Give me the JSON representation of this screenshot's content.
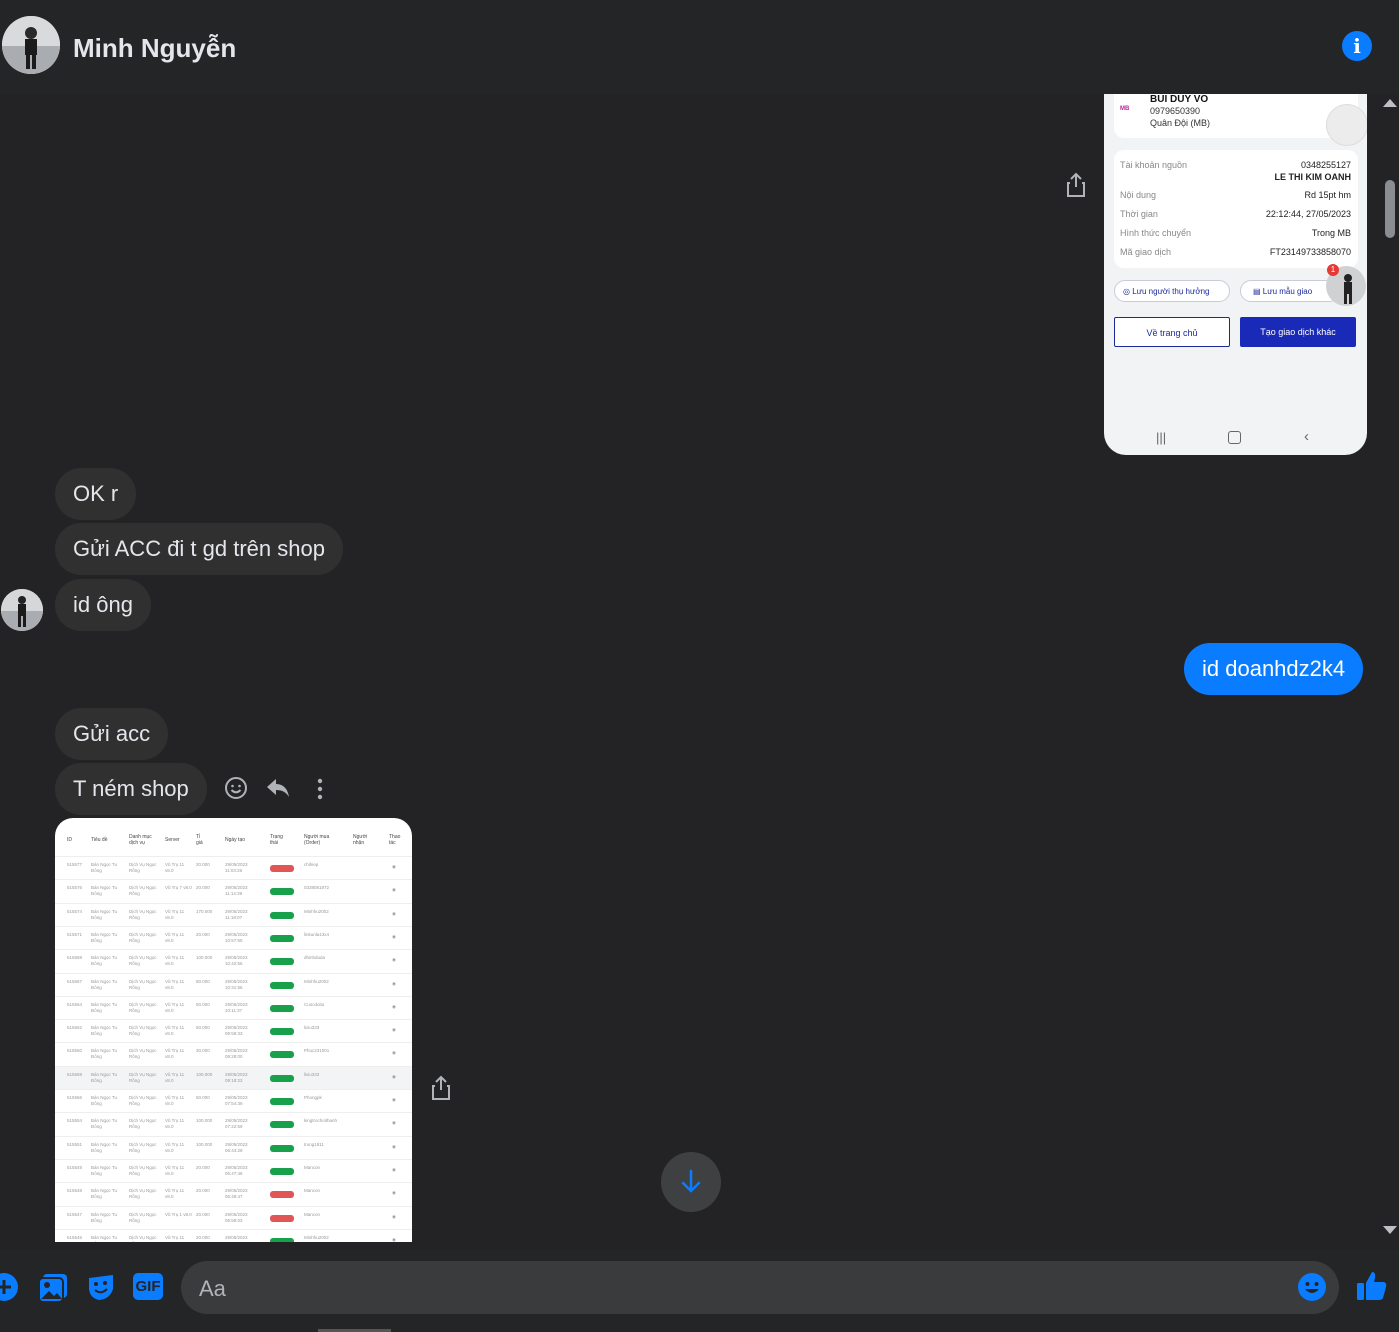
{
  "header": {
    "contact_name": "Minh Nguyễn",
    "info_icon": "info-icon"
  },
  "messages": {
    "m1": "OK r",
    "m2": "Gửi ACC đi t gd trên shop",
    "m3": "id ông",
    "m4": "id doanhdz2k4",
    "m5": "Gửi acc",
    "m6": "T ném shop"
  },
  "receipt": {
    "name": "BUI DUY VO",
    "phone": "0979650390",
    "bank": "Quân Đội (MB)",
    "bank_logo": "MB",
    "source_label": "Tài khoản nguồn",
    "source_number": "0348255127",
    "source_name": "LE THI KIM OANH",
    "content_label": "Nội dung",
    "content_value": "Rd 15pt hm",
    "time_label": "Thời gian",
    "time_value": "22:12:44, 27/05/2023",
    "method_label": "Hình thức chuyển",
    "method_value": "Trong MB",
    "code_label": "Mã giao dịch",
    "code_value": "FT23149733858070",
    "save_payee": "Lưu người thụ hưởng",
    "save_template": "Lưu mẫu giao",
    "home_button": "Về trang chủ",
    "new_tx_button": "Tạo giao dịch khác",
    "badge": "1"
  },
  "table": {
    "headers": [
      "ID",
      "Tiêu đề",
      "Danh mục dịch vụ",
      "Server",
      "Tỉ giá",
      "Ngày tạo",
      "Trạng thái",
      "Người mua (Order)",
      "Người nhận",
      "Thao tác"
    ],
    "rows": [
      {
        "id": "515577",
        "title": "Bán Ngọc Tu Đông",
        "cat": "Dịch Vụ Ngọc Rồng",
        "server": "Vũ Trụ 11 v8.0",
        "rate": "20.000",
        "date": "29/05/2023 11:03:26",
        "status": "bad",
        "buyer": "chihiep"
      },
      {
        "id": "515576",
        "title": "Bán Ngọc Tu Đông",
        "cat": "Dịch Vụ Ngọc Rồng",
        "server": "Vũ Trụ 7 v8.0",
        "rate": "20.000",
        "date": "29/05/2023 11:14:39",
        "status": "ok",
        "buyer": "0338081872"
      },
      {
        "id": "515574",
        "title": "Bán Ngọc Tu Đông",
        "cat": "Dịch Vụ Ngọc Rồng",
        "server": "Vũ Trụ 11 v8.0",
        "rate": "170.000",
        "date": "29/05/2023 11:18:07",
        "status": "ok",
        "buyer": "Minhhu2002"
      },
      {
        "id": "515571",
        "title": "Bán Ngọc Tu Đông",
        "cat": "Dịch Vụ Ngọc Rồng",
        "server": "Vũ Trụ 11 v8.0",
        "rate": "20.000",
        "date": "29/05/2023 10:57:55",
        "status": "ok",
        "buyer": "linkunla13x4"
      },
      {
        "id": "515569",
        "title": "Bán Ngọc Tu Đông",
        "cat": "Dịch Vụ Ngọc Rồng",
        "server": "Vũ Trụ 11 v8.0",
        "rate": "100.000",
        "date": "29/05/2023 10:42:56",
        "status": "ok",
        "buyer": "dhinhduda"
      },
      {
        "id": "515567",
        "title": "Bán Ngọc Tu Đông",
        "cat": "Dịch Vụ Ngọc Rồng",
        "server": "Vũ Trụ 11 v8.0",
        "rate": "80.000",
        "date": "29/05/2023 10:31:56",
        "status": "ok",
        "buyer": "Minhhu2002"
      },
      {
        "id": "515564",
        "title": "Bán Ngọc Tu Đông",
        "cat": "Dịch Vụ Ngọc Rồng",
        "server": "Vũ Trụ 11 v8.0",
        "rate": "50.000",
        "date": "29/05/2023 10:11:37",
        "status": "ok",
        "buyer": "Cuocdoitu"
      },
      {
        "id": "515562",
        "title": "Bán Ngọc Tu Đông",
        "cat": "Dịch Vụ Ngọc Rồng",
        "server": "Vũ Trụ 11 v8.0",
        "rate": "50.000",
        "date": "29/05/2023 09:58:33",
        "status": "ok",
        "buyer": "liviu333"
      },
      {
        "id": "515560",
        "title": "Bán Ngọc Tu Đông",
        "cat": "Dịch Vụ Ngọc Rồng",
        "server": "Vũ Trụ 11 v8.0",
        "rate": "30.000",
        "date": "29/05/2023 09:28:00",
        "status": "ok",
        "buyer": "Phuc231001"
      },
      {
        "id": "515559",
        "title": "Bán Ngọc Tu Đông",
        "cat": "Dịch Vụ Ngọc Rồng",
        "server": "Vũ Trụ 11 v8.0",
        "rate": "100.000",
        "date": "29/05/2023 09:18:23",
        "status": "ok",
        "buyer": "liviu333"
      },
      {
        "id": "515556",
        "title": "Bán Ngọc Tu Đông",
        "cat": "Dịch Vụ Ngọc Rồng",
        "server": "Vũ Trụ 11 v8.0",
        "rate": "50.000",
        "date": "29/05/2023 07:54:39",
        "status": "ok",
        "buyer": "Phongpk"
      },
      {
        "id": "515554",
        "title": "Bán Ngọc Tu Đông",
        "cat": "Dịch Vụ Ngọc Rồng",
        "server": "Vũ Trụ 11 v8.0",
        "rate": "100.000",
        "date": "29/05/2023 07:22:59",
        "status": "ok",
        "buyer": "kingtrochoithanh"
      },
      {
        "id": "515551",
        "title": "Bán Ngọc Tu Đông",
        "cat": "Dịch Vụ Ngọc Rồng",
        "server": "Vũ Trụ 11 v8.0",
        "rate": "100.000",
        "date": "29/05/2023 06:44:28",
        "status": "ok",
        "buyer": "trung1811"
      },
      {
        "id": "515549",
        "title": "Bán Ngọc Tu Đông",
        "cat": "Dịch Vụ Ngọc Rồng",
        "server": "Vũ Trụ 11 v8.0",
        "rate": "20.000",
        "date": "29/05/2023 05:47:46",
        "status": "ok",
        "buyer": "Mancon"
      },
      {
        "id": "515548",
        "title": "Bán Ngọc Tu Đông",
        "cat": "Dịch Vụ Ngọc Rồng",
        "server": "Vũ Trụ 11 v8.0",
        "rate": "20.000",
        "date": "29/05/2023 05:48:47",
        "status": "bad",
        "buyer": "Mancon"
      },
      {
        "id": "515547",
        "title": "Bán Ngọc Tu Đông",
        "cat": "Dịch Vụ Ngọc Rồng",
        "server": "Vũ Trụ 1 v8.0",
        "rate": "20.000",
        "date": "29/05/2023 05:59:03",
        "status": "bad",
        "buyer": "Mancon"
      },
      {
        "id": "515545",
        "title": "Bán Ngọc Tu Đông",
        "cat": "Dịch Vụ Ngọc Rồng",
        "server": "Vũ Trụ 11",
        "rate": "20.000",
        "date": "29/05/2023",
        "status": "ok",
        "buyer": "Minhhu2002"
      }
    ]
  },
  "composer": {
    "placeholder": "Aa",
    "gif_label": "GIF"
  },
  "colors": {
    "background": "#232325",
    "bubble_other": "#303030",
    "bubble_mine": "#0a7cff",
    "accent": "#0a7cff"
  }
}
